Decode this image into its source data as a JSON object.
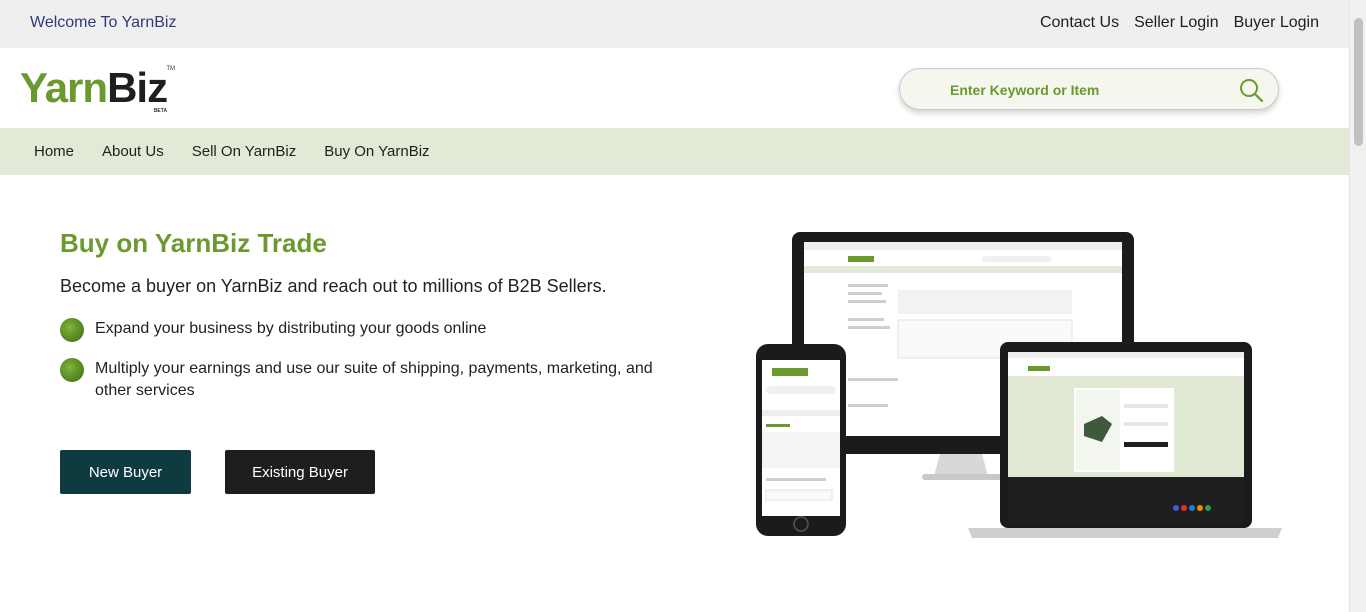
{
  "topbar": {
    "welcome": "Welcome To YarnBiz",
    "links": [
      "Contact Us",
      "Seller Login",
      "Buyer Login"
    ]
  },
  "header": {
    "logo_part1": "Yarn",
    "logo_part2": "Biz",
    "logo_tm": "TM",
    "logo_beta": "BETA",
    "search_placeholder": "Enter Keyword or Item"
  },
  "nav": {
    "items": [
      "Home",
      "About Us",
      "Sell On YarnBiz",
      "Buy On YarnBiz"
    ]
  },
  "hero": {
    "title": "Buy on YarnBiz Trade",
    "subtitle": "Become a buyer on YarnBiz and reach out to millions of B2B Sellers.",
    "bullets": [
      "Expand your business by distributing your goods online",
      "Multiply your earnings and use our suite of shipping, payments, marketing, and other services"
    ],
    "new_buyer_label": "New Buyer",
    "existing_buyer_label": "Existing Buyer"
  },
  "colors": {
    "brand_green": "#6a9a2e",
    "nav_bg": "#e3e9d7",
    "topbar_bg": "#efefef",
    "btn_new": "#0f3b40",
    "btn_existing": "#1e1e1e"
  },
  "icons": {
    "search": "search-icon",
    "bullet": "yarn-ball-icon"
  }
}
